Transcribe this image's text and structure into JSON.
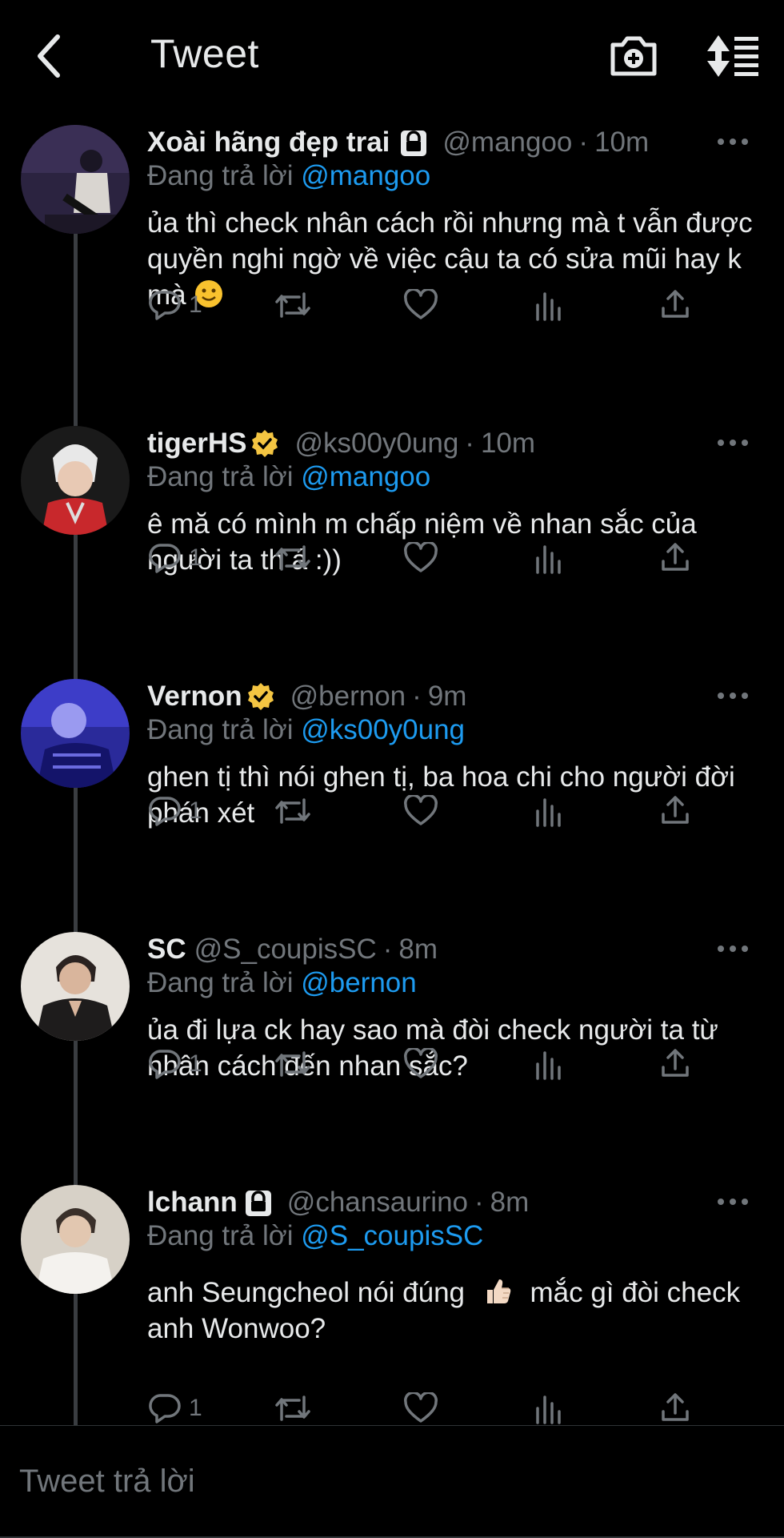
{
  "header": {
    "title": "Tweet"
  },
  "reply_prefix": "Đang trả lời",
  "tweets": [
    {
      "name": "Xoài hãng đẹp trai",
      "badge": "lock",
      "handle": "@mangoo",
      "sep": "·",
      "time": "10m",
      "replying_to": "@mangoo",
      "text": "ủa thì check nhân cách rồi nhưng mà t vẫn được quyền nghi ngờ về việc cậu ta có sửa mũi hay k mà",
      "emoji": "slightly-smiling-face",
      "replies": "1"
    },
    {
      "name": "tigerHS",
      "badge": "verified",
      "handle": "@ks00y0ung",
      "sep": "·",
      "time": "10m",
      "replying_to": "@mangoo",
      "text": "ê mă có mình m chấp niệm về nhan sắc của người ta th á :))",
      "replies": "1"
    },
    {
      "name": "Vernon",
      "badge": "verified",
      "handle": "@bernon",
      "sep": "·",
      "time": "9m",
      "replying_to": "@ks00y0ung",
      "text": "ghen tị thì nói ghen tị, ba hoa chi cho người đời phán xét",
      "replies": "1"
    },
    {
      "name": "SC",
      "badge": "",
      "handle": "@S_coupisSC",
      "sep": "·",
      "time": "8m",
      "replying_to": "@bernon",
      "text": "ủa đi lựa ck hay sao mà đòi check người ta từ nhân cách đến nhan sắc?",
      "replies": "1"
    },
    {
      "name": "lchann",
      "badge": "lock",
      "handle": "@chansaurino",
      "sep": "·",
      "time": "8m",
      "replying_to": "@S_coupisSC",
      "text_before": "anh Seungcheol nói đúng",
      "emoji": "thumbs-up",
      "text_after": "mắc gì đòi check anh Wonwoo?",
      "replies": "1"
    }
  ],
  "compose": {
    "placeholder": "Tweet trả lời"
  },
  "colors": {
    "background": "#000000",
    "text": "#e7e9ea",
    "muted": "#71767b",
    "link": "#1d9bf0",
    "verified": "#f4c542"
  }
}
